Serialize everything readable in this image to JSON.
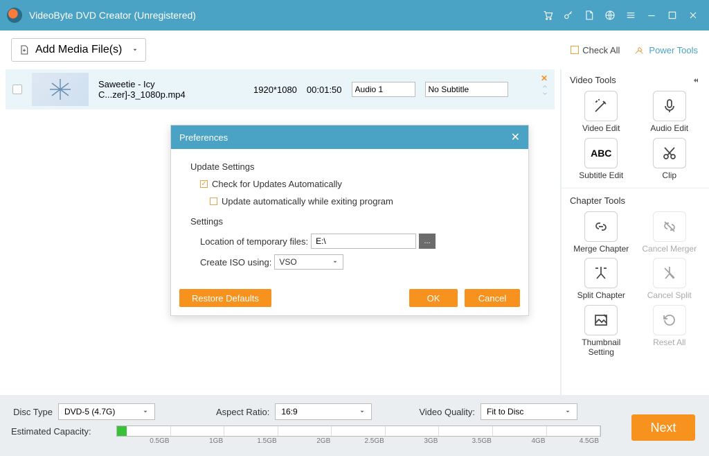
{
  "title": "VideoByte DVD Creator (Unregistered)",
  "toolbar": {
    "add_media": "Add Media File(s)",
    "check_all": "Check All",
    "power_tools": "Power Tools"
  },
  "media": {
    "name": "Saweetie - Icy C...zer]-3_1080p.mp4",
    "resolution": "1920*1080",
    "duration": "00:01:50",
    "audio": "Audio 1",
    "subtitle": "No Subtitle"
  },
  "prefs": {
    "title": "Preferences",
    "update_section": "Update Settings",
    "check_updates": "Check for Updates Automatically",
    "update_on_exit": "Update automatically while exiting program",
    "settings_section": "Settings",
    "temp_label": "Location of temporary files:",
    "temp_value": "E:\\",
    "iso_label": "Create ISO using:",
    "iso_value": "VSO",
    "restore": "Restore Defaults",
    "ok": "OK",
    "cancel": "Cancel",
    "browse": "..."
  },
  "right": {
    "video_tools": "Video Tools",
    "video_edit": "Video Edit",
    "audio_edit": "Audio Edit",
    "subtitle_edit": "Subtitle Edit",
    "clip": "Clip",
    "chapter_tools": "Chapter Tools",
    "merge_chapter": "Merge Chapter",
    "cancel_merger": "Cancel Merger",
    "split_chapter": "Split Chapter",
    "cancel_split": "Cancel Split",
    "thumbnail": "Thumbnail Setting",
    "reset_all": "Reset All"
  },
  "bottom": {
    "disc_type_lbl": "Disc Type",
    "disc_type": "DVD-5 (4.7G)",
    "aspect_lbl": "Aspect Ratio:",
    "aspect": "16:9",
    "quality_lbl": "Video Quality:",
    "quality": "Fit to Disc",
    "capacity_lbl": "Estimated Capacity:",
    "ticks": [
      "0.5GB",
      "1GB",
      "1.5GB",
      "2GB",
      "2.5GB",
      "3GB",
      "3.5GB",
      "4GB",
      "4.5GB"
    ],
    "next": "Next"
  }
}
